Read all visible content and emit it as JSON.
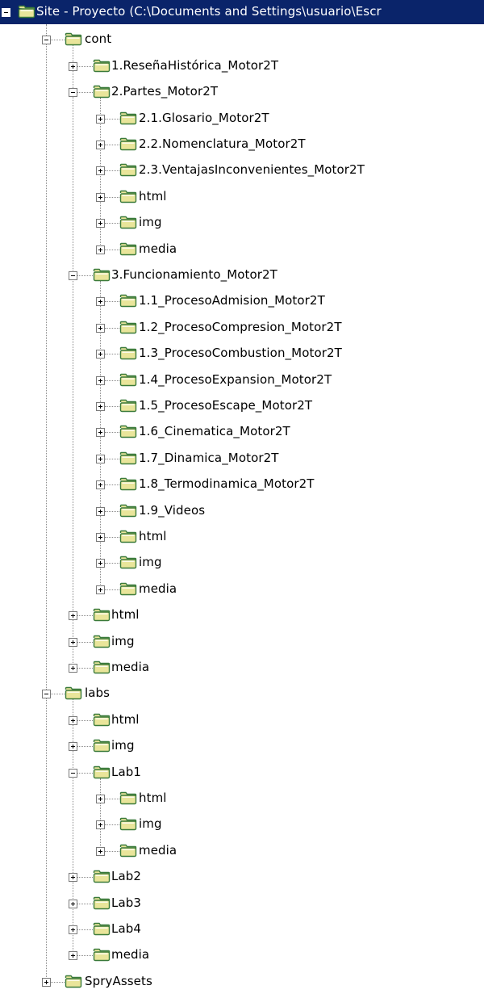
{
  "tree": {
    "nodes": [
      {
        "label": "Site - Proyecto (C:\\Documents and Settings\\usuario\\Escr",
        "depth": 0,
        "expanded": true,
        "selected": true
      },
      {
        "label": "cont",
        "depth": 1,
        "expanded": true
      },
      {
        "label": "1.ReseñaHistórica_Motor2T",
        "depth": 2,
        "expanded": false
      },
      {
        "label": "2.Partes_Motor2T",
        "depth": 2,
        "expanded": true
      },
      {
        "label": "2.1.Glosario_Motor2T",
        "depth": 3,
        "expanded": false
      },
      {
        "label": "2.2.Nomenclatura_Motor2T",
        "depth": 3,
        "expanded": false
      },
      {
        "label": "2.3.VentajasInconvenientes_Motor2T",
        "depth": 3,
        "expanded": false
      },
      {
        "label": "html",
        "depth": 3,
        "expanded": false
      },
      {
        "label": "img",
        "depth": 3,
        "expanded": false
      },
      {
        "label": "media",
        "depth": 3,
        "expanded": false
      },
      {
        "label": "3.Funcionamiento_Motor2T",
        "depth": 2,
        "expanded": true
      },
      {
        "label": "1.1_ProcesoAdmision_Motor2T",
        "depth": 3,
        "expanded": false
      },
      {
        "label": "1.2_ProcesoCompresion_Motor2T",
        "depth": 3,
        "expanded": false
      },
      {
        "label": "1.3_ProcesoCombustion_Motor2T",
        "depth": 3,
        "expanded": false
      },
      {
        "label": "1.4_ProcesoExpansion_Motor2T",
        "depth": 3,
        "expanded": false
      },
      {
        "label": "1.5_ProcesoEscape_Motor2T",
        "depth": 3,
        "expanded": false
      },
      {
        "label": "1.6_Cinematica_Motor2T",
        "depth": 3,
        "expanded": false
      },
      {
        "label": "1.7_Dinamica_Motor2T",
        "depth": 3,
        "expanded": false
      },
      {
        "label": "1.8_Termodinamica_Motor2T",
        "depth": 3,
        "expanded": false
      },
      {
        "label": "1.9_Videos",
        "depth": 3,
        "expanded": false
      },
      {
        "label": "html",
        "depth": 3,
        "expanded": false
      },
      {
        "label": "img",
        "depth": 3,
        "expanded": false
      },
      {
        "label": "media",
        "depth": 3,
        "expanded": false
      },
      {
        "label": "html",
        "depth": 2,
        "expanded": false
      },
      {
        "label": "img",
        "depth": 2,
        "expanded": false
      },
      {
        "label": "media",
        "depth": 2,
        "expanded": false
      },
      {
        "label": "labs",
        "depth": 1,
        "expanded": true
      },
      {
        "label": "html",
        "depth": 2,
        "expanded": false
      },
      {
        "label": "img",
        "depth": 2,
        "expanded": false
      },
      {
        "label": "Lab1",
        "depth": 2,
        "expanded": true
      },
      {
        "label": "html",
        "depth": 3,
        "expanded": false
      },
      {
        "label": "img",
        "depth": 3,
        "expanded": false
      },
      {
        "label": "media",
        "depth": 3,
        "expanded": false
      },
      {
        "label": "Lab2",
        "depth": 2,
        "expanded": false
      },
      {
        "label": "Lab3",
        "depth": 2,
        "expanded": false
      },
      {
        "label": "Lab4",
        "depth": 2,
        "expanded": false
      },
      {
        "label": "media",
        "depth": 2,
        "expanded": false
      },
      {
        "label": "SpryAssets",
        "depth": 1,
        "expanded": false
      }
    ]
  },
  "icons": {
    "folder": "folder-icon",
    "expand": "plus-box-icon",
    "collapse": "minus-box-icon"
  },
  "colors": {
    "selection": "#0a246a",
    "folder_fill": "#e9e59a",
    "folder_outline": "#3a7a3a",
    "tree_line": "#8a8a8a"
  }
}
